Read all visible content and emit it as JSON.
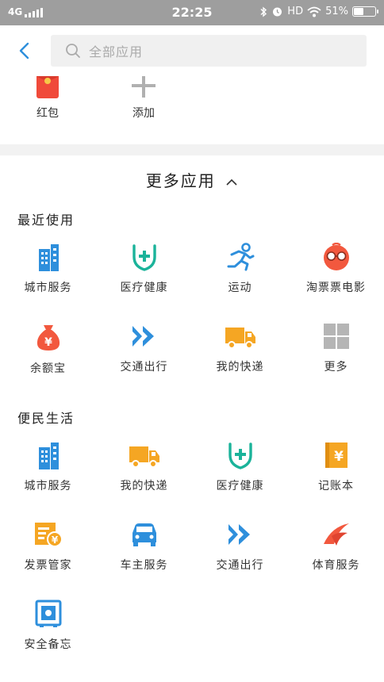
{
  "status_bar": {
    "network": "4G",
    "time": "22:25",
    "hd": "HD",
    "battery": "51%",
    "battery_level": 0.51
  },
  "search": {
    "placeholder": "全部应用",
    "icons": {
      "back": "back-arrow-icon",
      "search": "search-icon"
    }
  },
  "added": [
    {
      "label": "红包",
      "icon": "red-packet-icon",
      "color": "#f04a3a"
    },
    {
      "label": "添加",
      "icon": "plus-icon",
      "color": "#b0b0b0"
    }
  ],
  "more_apps": {
    "title": "更多应用",
    "caret_icon": "chevron-up-icon"
  },
  "recent": {
    "title": "最近使用",
    "items": [
      {
        "label": "城市服务",
        "icon": "city-building-icon",
        "color": "#2e8fdc"
      },
      {
        "label": "医疗健康",
        "icon": "medical-shield-icon",
        "color": "#1bb39a"
      },
      {
        "label": "运动",
        "icon": "running-person-icon",
        "color": "#2e8fdc"
      },
      {
        "label": "淘票票电影",
        "icon": "glasses-face-icon",
        "color": "#f2583e"
      },
      {
        "label": "余额宝",
        "icon": "money-bag-icon",
        "color": "#f2583e"
      },
      {
        "label": "交通出行",
        "icon": "double-chevron-icon",
        "color": "#2e8fdc"
      },
      {
        "label": "我的快递",
        "icon": "delivery-truck-icon",
        "color": "#f5a623"
      },
      {
        "label": "更多",
        "icon": "grid-more-icon",
        "color": "#b5b5b5"
      }
    ]
  },
  "life": {
    "title": "便民生活",
    "items": [
      {
        "label": "城市服务",
        "icon": "city-building-icon",
        "color": "#2e8fdc"
      },
      {
        "label": "我的快递",
        "icon": "delivery-truck-icon",
        "color": "#f5a623"
      },
      {
        "label": "医疗健康",
        "icon": "medical-shield-icon",
        "color": "#1bb39a"
      },
      {
        "label": "记账本",
        "icon": "ledger-book-icon",
        "color": "#f5a623"
      },
      {
        "label": "发票管家",
        "icon": "invoice-icon",
        "color": "#f5a623"
      },
      {
        "label": "车主服务",
        "icon": "car-icon",
        "color": "#2e8fdc"
      },
      {
        "label": "交通出行",
        "icon": "double-chevron-icon",
        "color": "#2e8fdc"
      },
      {
        "label": "体育服务",
        "icon": "sports-swoosh-icon",
        "color": "#f2583e"
      },
      {
        "label": "安全备忘",
        "icon": "safe-box-icon",
        "color": "#2e8fdc"
      }
    ]
  }
}
